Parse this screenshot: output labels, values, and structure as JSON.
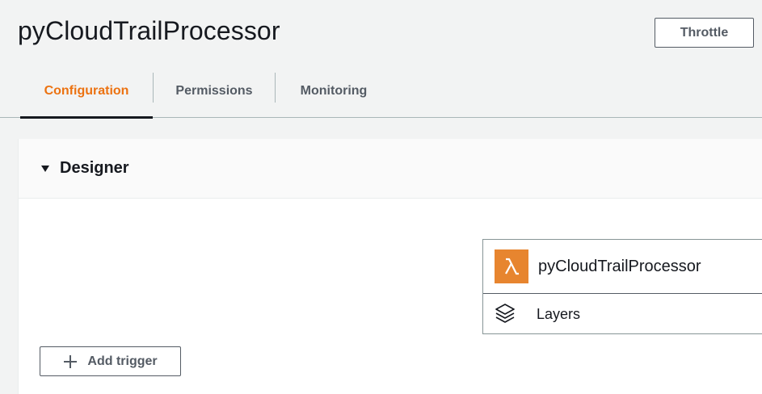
{
  "page": {
    "title": "pyCloudTrailProcessor",
    "throttle_label": "Throttle"
  },
  "tabs": [
    {
      "label": "Configuration",
      "active": true
    },
    {
      "label": "Permissions",
      "active": false
    },
    {
      "label": "Monitoring",
      "active": false
    }
  ],
  "designer": {
    "title": "Designer",
    "function_name": "pyCloudTrailProcessor",
    "function_icon": "lambda-icon",
    "layers_label": "Layers",
    "layers_icon": "layers-icon",
    "add_trigger_label": "Add trigger"
  },
  "colors": {
    "accent": "#ec7211",
    "lambda_bg": "#e7852f",
    "text": "#16191f",
    "secondary_text": "#545b64"
  }
}
